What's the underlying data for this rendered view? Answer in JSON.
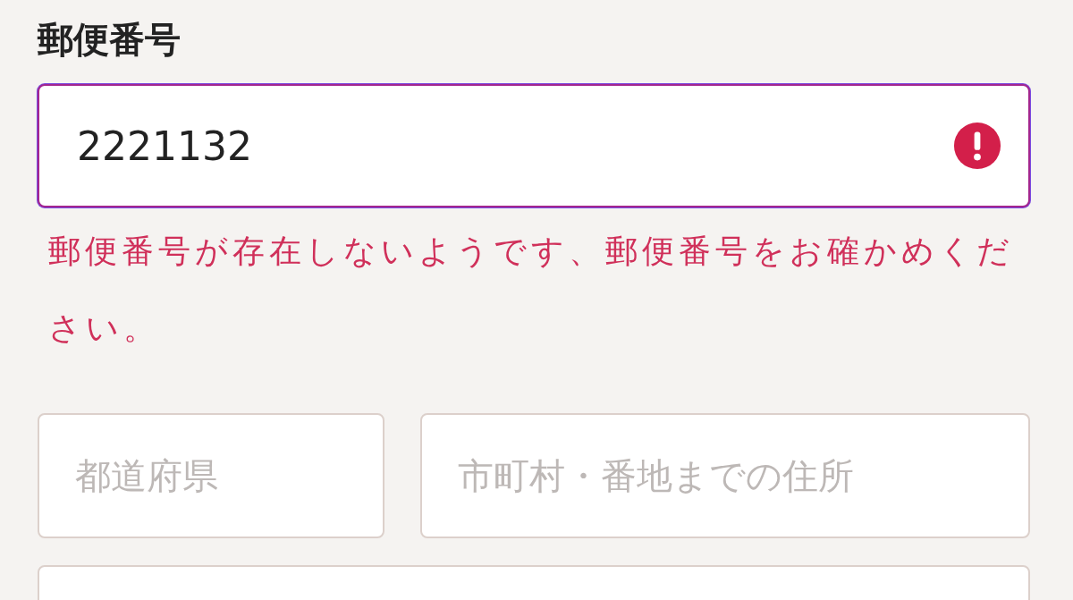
{
  "postal_code": {
    "label": "郵便番号",
    "value": "2221132",
    "error": true,
    "error_message": "郵便番号が存在しないようです、郵便番号をお確かめください。"
  },
  "address_fields": [
    {
      "placeholder": "都道府県"
    },
    {
      "placeholder": "市町村・番地までの住所"
    }
  ],
  "next_field": {
    "kind": "field"
  }
}
